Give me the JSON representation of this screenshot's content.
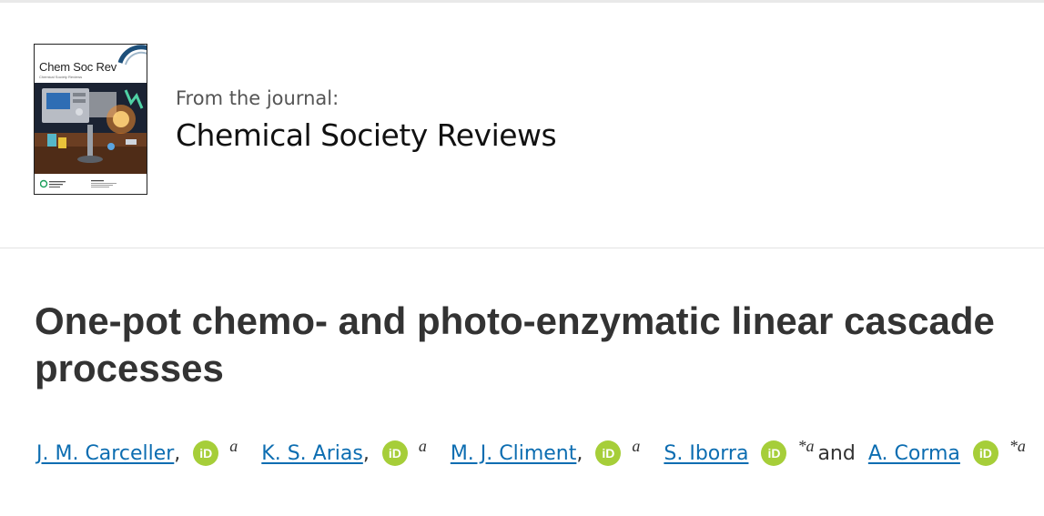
{
  "journal": {
    "cover_title": "Chem Soc Rev",
    "cover_subtitle": "Chemical Society Reviews",
    "from_label": "From the journal:",
    "name": "Chemical Society Reviews"
  },
  "article": {
    "title": "One-pot chemo- and photo-enzymatic linear cascade processes"
  },
  "authors": [
    {
      "name": "J. M. Carceller",
      "sep": ",",
      "aff": "a"
    },
    {
      "name": "K. S. Arias",
      "sep": ",",
      "aff": "a"
    },
    {
      "name": "M. J. Climent",
      "sep": ",",
      "aff": "a"
    },
    {
      "name": "S. Iborra",
      "sep": "",
      "aff": "*a"
    },
    {
      "name": "A. Corma",
      "sep": "",
      "aff": "*a"
    }
  ],
  "authors_conjunction": "and",
  "orcid_label": "iD",
  "colors": {
    "link": "#0c6db1",
    "orcid": "#a6ce39",
    "title": "#333333"
  }
}
